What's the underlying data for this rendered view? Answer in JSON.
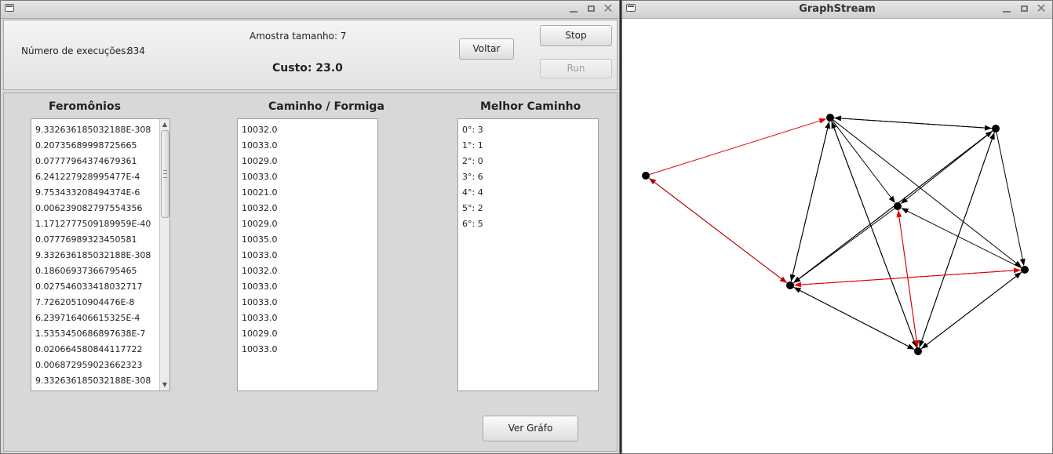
{
  "left_window": {
    "top": {
      "sample_size": "Amostra tamanho: 7",
      "executions_label": "Número de execuções:",
      "executions_value": "834",
      "cost": "Custo: 23.0",
      "back_label": "Voltar",
      "stop_label": "Stop",
      "run_label": "Run"
    },
    "pheromones": {
      "header": "Feromônios",
      "items": [
        "9.332636185032188E-308",
        "0.20735689998725665",
        "0.07777964374679361",
        "6.241227928995477E-4",
        "9.753433208494374E-6",
        "0.006239082797554356",
        "1.1712777509189959E-40",
        "0.07776989323450581",
        "9.332636185032188E-308",
        "0.18606937366795465",
        "0.027546033418032717",
        "7.72620510904476E-8",
        "6.239716406615325E-4",
        "1.5353450686897638E-7",
        "0.020664580844117722",
        "0.006872959023662323",
        "9.332636185032188E-308"
      ]
    },
    "path_ant": {
      "header": "Caminho / Formiga",
      "items": [
        "10032.0",
        "10033.0",
        "10029.0",
        "10033.0",
        "10021.0",
        "10032.0",
        "10029.0",
        "10035.0",
        "10033.0",
        "10032.0",
        "10033.0",
        "10033.0",
        "10033.0",
        "10029.0",
        "10033.0"
      ]
    },
    "best_path": {
      "header": "Melhor Caminho",
      "items": [
        "0°: 3",
        "1°: 1",
        "2°: 0",
        "3°: 6",
        "4°: 4",
        "5°: 2",
        "6°: 5"
      ]
    },
    "view_graph_label": "Ver Gráfo"
  },
  "right_window": {
    "title": "GraphStream",
    "graph": {
      "nodes": [
        {
          "id": "n0"
        },
        {
          "id": "n1"
        },
        {
          "id": "n2"
        },
        {
          "id": "n3"
        },
        {
          "id": "n4"
        },
        {
          "id": "n5"
        },
        {
          "id": "n6"
        }
      ],
      "edges": [
        {
          "from": "n0",
          "to": "n1",
          "color": "#e00000"
        },
        {
          "from": "n0",
          "to": "n4",
          "color": "#b00000"
        },
        {
          "from": "n4",
          "to": "n0",
          "color": "#b00000"
        },
        {
          "from": "n1",
          "to": "n2",
          "color": "#000000"
        },
        {
          "from": "n2",
          "to": "n1",
          "color": "#000000"
        },
        {
          "from": "n1",
          "to": "n3",
          "color": "#000000"
        },
        {
          "from": "n1",
          "to": "n5",
          "color": "#000000"
        },
        {
          "from": "n1",
          "to": "n4",
          "color": "#000000"
        },
        {
          "from": "n4",
          "to": "n1",
          "color": "#000000"
        },
        {
          "from": "n1",
          "to": "n6",
          "color": "#000000"
        },
        {
          "from": "n6",
          "to": "n1",
          "color": "#000000"
        },
        {
          "from": "n2",
          "to": "n4",
          "color": "#000000"
        },
        {
          "from": "n4",
          "to": "n2",
          "color": "#000000"
        },
        {
          "from": "n2",
          "to": "n3",
          "color": "#000000"
        },
        {
          "from": "n2",
          "to": "n5",
          "color": "#000000"
        },
        {
          "from": "n2",
          "to": "n6",
          "color": "#000000"
        },
        {
          "from": "n6",
          "to": "n2",
          "color": "#000000"
        },
        {
          "from": "n3",
          "to": "n4",
          "color": "#000000"
        },
        {
          "from": "n5",
          "to": "n3",
          "color": "#000000"
        },
        {
          "from": "n3",
          "to": "n6",
          "color": "#e00000"
        },
        {
          "from": "n6",
          "to": "n3",
          "color": "#e00000"
        },
        {
          "from": "n4",
          "to": "n5",
          "color": "#e00000"
        },
        {
          "from": "n5",
          "to": "n4",
          "color": "#e00000"
        },
        {
          "from": "n4",
          "to": "n6",
          "color": "#000000"
        },
        {
          "from": "n6",
          "to": "n4",
          "color": "#000000"
        },
        {
          "from": "n5",
          "to": "n6",
          "color": "#000000"
        },
        {
          "from": "n6",
          "to": "n5",
          "color": "#000000"
        }
      ]
    }
  }
}
